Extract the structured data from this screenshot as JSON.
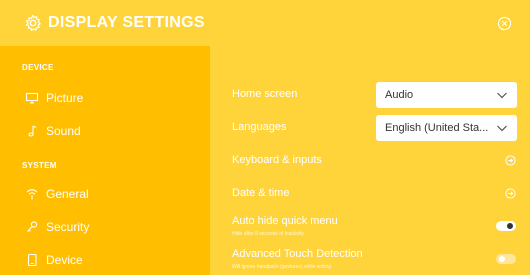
{
  "header": {
    "title": "DISPLAY SETTINGS"
  },
  "sidebar": {
    "sections": [
      {
        "title": "DEVICE",
        "items": [
          {
            "label": "Picture",
            "icon": "monitor-icon"
          },
          {
            "label": "Sound",
            "icon": "music-note-icon"
          }
        ]
      },
      {
        "title": "SYSTEM",
        "items": [
          {
            "label": "General",
            "icon": "wifi-icon"
          },
          {
            "label": "Security",
            "icon": "key-icon"
          },
          {
            "label": "Device",
            "icon": "phone-icon"
          }
        ]
      }
    ]
  },
  "main": {
    "rows": [
      {
        "label": "Home screen",
        "type": "select",
        "value": "Audio"
      },
      {
        "label": "Languages",
        "type": "select",
        "value": "English (United Sta..."
      },
      {
        "label": "Keyboard & inputs",
        "type": "link"
      },
      {
        "label": "Date & time",
        "type": "link"
      },
      {
        "label": "Auto hide quick menu",
        "sublabel": "Hide after 8 seconds of inactivity",
        "type": "toggle",
        "on": true
      },
      {
        "label": "Advanced Touch Detection",
        "sublabel": "Will ignore handpalm (gestures) while writing",
        "type": "toggle",
        "on": false
      }
    ]
  },
  "colors": {
    "header_bg": "#ffd43b",
    "sidebar_bg": "#ffbf00",
    "main_bg": "#ffd43b",
    "text": "#ffffff"
  }
}
